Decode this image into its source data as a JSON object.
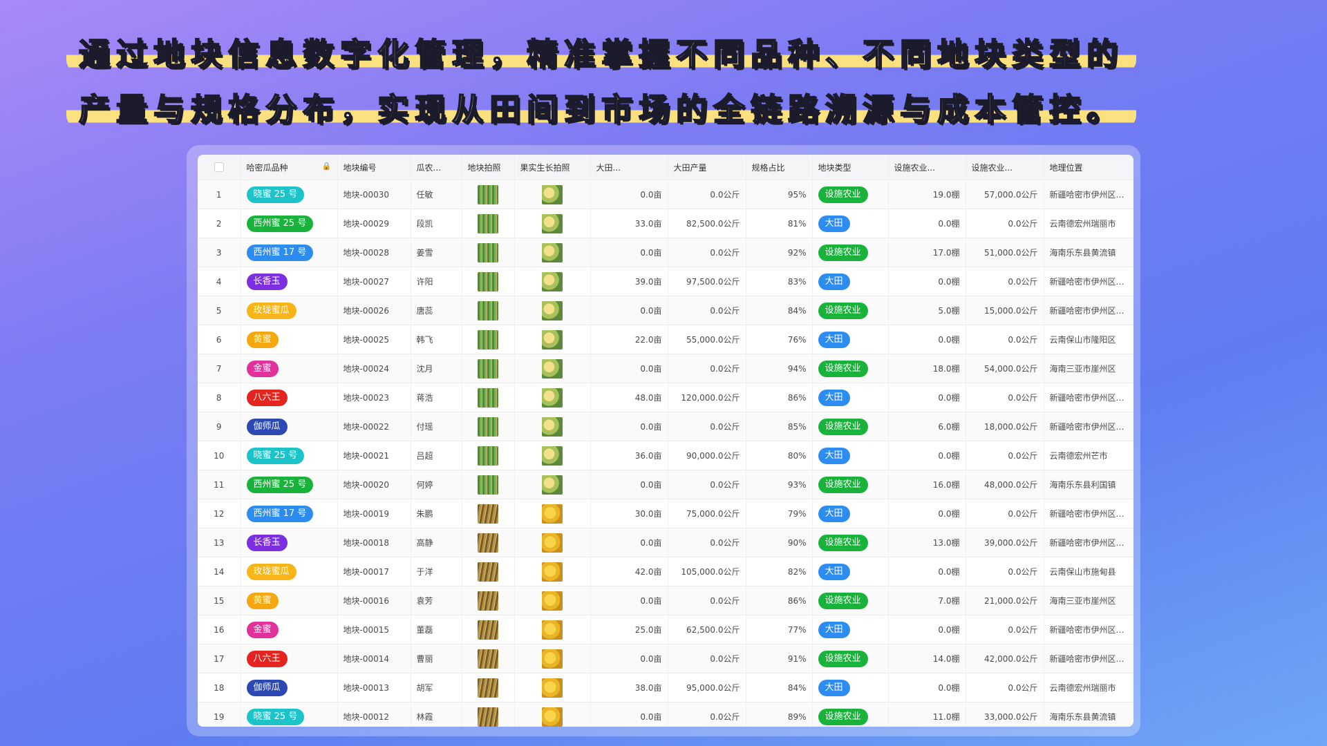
{
  "headline": {
    "line1": "通过地块信息数字化管理，精准掌握不同品种、不同地块类型的",
    "line2": "产量与规格分布，实现从田间到市场的全链路溯源与成本管控。"
  },
  "table": {
    "columns": [
      "哈密瓜品种",
      "地块编号",
      "瓜农...",
      "地块拍照",
      "果实生长拍照",
      "大田...",
      "大田产量",
      "规格占比",
      "地块类型",
      "设施农业...",
      "设施农业...",
      "地理位置"
    ],
    "rows": [
      {
        "idx": "1",
        "variety": "晓蜜 25 号",
        "variety_color": "#1cc3c8",
        "plot": "地块-00030",
        "farmer": "任敏",
        "field_area": "0.0亩",
        "field_yield": "0.0公斤",
        "ratio": "95%",
        "type": "设施农业",
        "type_color": "#19b33b",
        "fac_count": "19.0棚",
        "fac_yield": "57,000.0公斤",
        "location": "新疆哈密市伊州区大...",
        "photo_style": "green"
      },
      {
        "idx": "2",
        "variety": "西州蜜 25 号",
        "variety_color": "#19b33b",
        "plot": "地块-00029",
        "farmer": "段凯",
        "field_area": "33.0亩",
        "field_yield": "82,500.0公斤",
        "ratio": "81%",
        "type": "大田",
        "type_color": "#2d8cf0",
        "fac_count": "0.0棚",
        "fac_yield": "0.0公斤",
        "location": "云南德宏州瑞丽市",
        "photo_style": "green"
      },
      {
        "idx": "3",
        "variety": "西州蜜 17 号",
        "variety_color": "#2d8cf0",
        "plot": "地块-00028",
        "farmer": "姜雪",
        "field_area": "0.0亩",
        "field_yield": "0.0公斤",
        "ratio": "92%",
        "type": "设施农业",
        "type_color": "#19b33b",
        "fac_count": "17.0棚",
        "fac_yield": "51,000.0公斤",
        "location": "海南乐东县黄流镇",
        "photo_style": "green"
      },
      {
        "idx": "4",
        "variety": "长香玉",
        "variety_color": "#7b2fe0",
        "plot": "地块-00027",
        "farmer": "许阳",
        "field_area": "39.0亩",
        "field_yield": "97,500.0公斤",
        "ratio": "83%",
        "type": "大田",
        "type_color": "#2d8cf0",
        "fac_count": "0.0棚",
        "fac_yield": "0.0公斤",
        "location": "新疆哈密市伊州区五...",
        "photo_style": "green"
      },
      {
        "idx": "5",
        "variety": "玫珑蜜瓜",
        "variety_color": "#f7b51a",
        "plot": "地块-00026",
        "farmer": "唐蕊",
        "field_area": "0.0亩",
        "field_yield": "0.0公斤",
        "ratio": "84%",
        "type": "设施农业",
        "type_color": "#19b33b",
        "fac_count": "5.0棚",
        "fac_yield": "15,000.0公斤",
        "location": "新疆哈密市伊州区陶...",
        "photo_style": "green"
      },
      {
        "idx": "6",
        "variety": "黄蜜",
        "variety_color": "#f5a70f",
        "plot": "地块-00025",
        "farmer": "韩飞",
        "field_area": "22.0亩",
        "field_yield": "55,000.0公斤",
        "ratio": "76%",
        "type": "大田",
        "type_color": "#2d8cf0",
        "fac_count": "0.0棚",
        "fac_yield": "0.0公斤",
        "location": "云南保山市隆阳区",
        "photo_style": "green"
      },
      {
        "idx": "7",
        "variety": "金蜜",
        "variety_color": "#e0329a",
        "plot": "地块-00024",
        "farmer": "沈月",
        "field_area": "0.0亩",
        "field_yield": "0.0公斤",
        "ratio": "94%",
        "type": "设施农业",
        "type_color": "#19b33b",
        "fac_count": "18.0棚",
        "fac_yield": "54,000.0公斤",
        "location": "海南三亚市崖州区",
        "photo_style": "green"
      },
      {
        "idx": "8",
        "variety": "八六王",
        "variety_color": "#e3241f",
        "plot": "地块-00023",
        "farmer": "蒋浩",
        "field_area": "48.0亩",
        "field_yield": "120,000.0公斤",
        "ratio": "86%",
        "type": "大田",
        "type_color": "#2d8cf0",
        "fac_count": "0.0棚",
        "fac_yield": "0.0公斤",
        "location": "新疆哈密市伊州区南...",
        "photo_style": "green"
      },
      {
        "idx": "9",
        "variety": "伽师瓜",
        "variety_color": "#2c49b3",
        "plot": "地块-00022",
        "farmer": "付瑶",
        "field_area": "0.0亩",
        "field_yield": "0.0公斤",
        "ratio": "85%",
        "type": "设施农业",
        "type_color": "#19b33b",
        "fac_count": "6.0棚",
        "fac_yield": "18,000.0公斤",
        "location": "新疆哈密市伊州区大...",
        "photo_style": "green"
      },
      {
        "idx": "10",
        "variety": "晓蜜 25 号",
        "variety_color": "#1cc3c8",
        "plot": "地块-00021",
        "farmer": "吕超",
        "field_area": "36.0亩",
        "field_yield": "90,000.0公斤",
        "ratio": "80%",
        "type": "大田",
        "type_color": "#2d8cf0",
        "fac_count": "0.0棚",
        "fac_yield": "0.0公斤",
        "location": "云南德宏州芒市",
        "photo_style": "green"
      },
      {
        "idx": "11",
        "variety": "西州蜜 25 号",
        "variety_color": "#19b33b",
        "plot": "地块-00020",
        "farmer": "何婷",
        "field_area": "0.0亩",
        "field_yield": "0.0公斤",
        "ratio": "93%",
        "type": "设施农业",
        "type_color": "#19b33b",
        "fac_count": "16.0棚",
        "fac_yield": "48,000.0公斤",
        "location": "海南乐东县利国镇",
        "photo_style": "green"
      },
      {
        "idx": "12",
        "variety": "西州蜜 17 号",
        "variety_color": "#2d8cf0",
        "plot": "地块-00019",
        "farmer": "朱鹏",
        "field_area": "30.0亩",
        "field_yield": "75,000.0公斤",
        "ratio": "79%",
        "type": "大田",
        "type_color": "#2d8cf0",
        "fac_count": "0.0棚",
        "fac_yield": "0.0公斤",
        "location": "新疆哈密市伊州区五...",
        "photo_style": "brown"
      },
      {
        "idx": "13",
        "variety": "长香玉",
        "variety_color": "#7b2fe0",
        "plot": "地块-00018",
        "farmer": "高静",
        "field_area": "0.0亩",
        "field_yield": "0.0公斤",
        "ratio": "90%",
        "type": "设施农业",
        "type_color": "#19b33b",
        "fac_count": "13.0棚",
        "fac_yield": "39,000.0公斤",
        "location": "新疆哈密市伊州区陶...",
        "photo_style": "brown"
      },
      {
        "idx": "14",
        "variety": "玫珑蜜瓜",
        "variety_color": "#f7b51a",
        "plot": "地块-00017",
        "farmer": "于洋",
        "field_area": "42.0亩",
        "field_yield": "105,000.0公斤",
        "ratio": "82%",
        "type": "大田",
        "type_color": "#2d8cf0",
        "fac_count": "0.0棚",
        "fac_yield": "0.0公斤",
        "location": "云南保山市施甸县",
        "photo_style": "brown"
      },
      {
        "idx": "15",
        "variety": "黄蜜",
        "variety_color": "#f5a70f",
        "plot": "地块-00016",
        "farmer": "袁芳",
        "field_area": "0.0亩",
        "field_yield": "0.0公斤",
        "ratio": "86%",
        "type": "设施农业",
        "type_color": "#19b33b",
        "fac_count": "7.0棚",
        "fac_yield": "21,000.0公斤",
        "location": "海南三亚市崖州区",
        "photo_style": "brown"
      },
      {
        "idx": "16",
        "variety": "金蜜",
        "variety_color": "#e0329a",
        "plot": "地块-00015",
        "farmer": "董磊",
        "field_area": "25.0亩",
        "field_yield": "62,500.0公斤",
        "ratio": "77%",
        "type": "大田",
        "type_color": "#2d8cf0",
        "fac_count": "0.0棚",
        "fac_yield": "0.0公斤",
        "location": "新疆哈密市伊州区南...",
        "photo_style": "brown"
      },
      {
        "idx": "17",
        "variety": "八六王",
        "variety_color": "#e3241f",
        "plot": "地块-00014",
        "farmer": "曹丽",
        "field_area": "0.0亩",
        "field_yield": "0.0公斤",
        "ratio": "91%",
        "type": "设施农业",
        "type_color": "#19b33b",
        "fac_count": "14.0棚",
        "fac_yield": "42,000.0公斤",
        "location": "新疆哈密市伊州区大...",
        "photo_style": "brown"
      },
      {
        "idx": "18",
        "variety": "伽师瓜",
        "variety_color": "#2c49b3",
        "plot": "地块-00013",
        "farmer": "胡军",
        "field_area": "38.0亩",
        "field_yield": "95,000.0公斤",
        "ratio": "84%",
        "type": "大田",
        "type_color": "#2d8cf0",
        "fac_count": "0.0棚",
        "fac_yield": "0.0公斤",
        "location": "云南德宏州瑞丽市",
        "photo_style": "brown"
      },
      {
        "idx": "19",
        "variety": "晓蜜 25 号",
        "variety_color": "#1cc3c8",
        "plot": "地块-00012",
        "farmer": "林霞",
        "field_area": "0.0亩",
        "field_yield": "0.0公斤",
        "ratio": "89%",
        "type": "设施农业",
        "type_color": "#19b33b",
        "fac_count": "11.0棚",
        "fac_yield": "33,000.0公斤",
        "location": "海南乐东县黄流镇",
        "photo_style": "brown"
      }
    ]
  }
}
